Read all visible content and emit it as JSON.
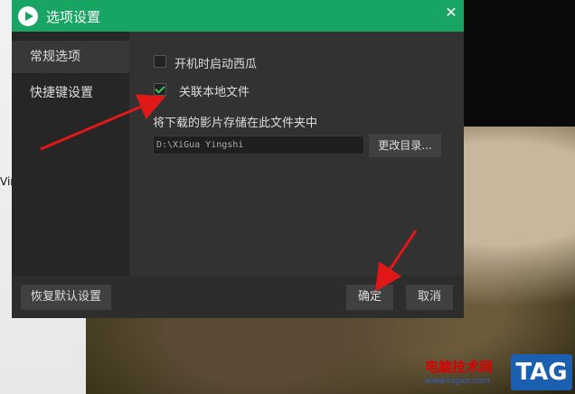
{
  "window": {
    "title": "选项设置"
  },
  "sidebar": {
    "items": [
      {
        "label": "常规选项",
        "active": true
      },
      {
        "label": "快捷键设置",
        "active": false
      }
    ]
  },
  "general": {
    "autostart_label": "开机时启动西瓜",
    "autostart_checked": false,
    "associate_label": "关联本地文件",
    "associate_checked": true,
    "download_folder_label": "将下载的影片存储在此文件夹中",
    "download_path": "D:\\XiGua Yingshi",
    "change_dir_button": "更改目录..."
  },
  "footer": {
    "restore_defaults": "恢复默认设置",
    "ok": "确定",
    "cancel": "取消"
  },
  "background": {
    "side_text": "Vin"
  },
  "watermark": {
    "site_name": "电脑技术网",
    "url": "www.tagxp.com",
    "tag": "TAG"
  },
  "colors": {
    "accent": "#18a462",
    "arrow": "#e01818"
  }
}
